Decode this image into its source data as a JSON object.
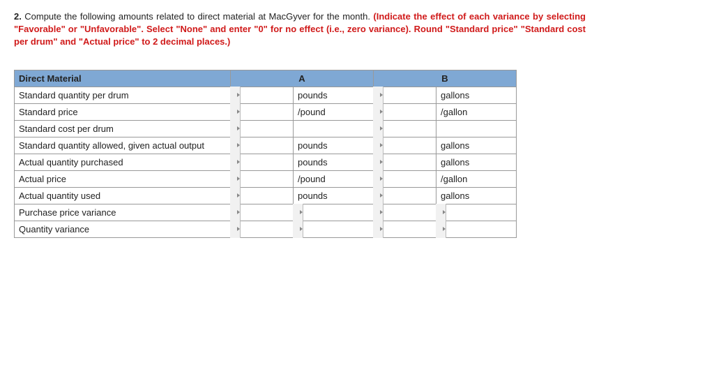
{
  "question": {
    "number": "2.",
    "prompt": "Compute the following amounts related to direct material at MacGyver for the month.",
    "instruction": "(Indicate the effect of each variance by selecting \"Favorable\" or \"Unfavorable\". Select \"None\" and enter \"0\" for no effect (i.e., zero variance). Round \"Standard price\" \"Standard cost per drum\" and \"Actual price\" to 2 decimal places.)"
  },
  "table": {
    "header": {
      "title": "Direct Material",
      "col_a": "A",
      "col_b": "B"
    },
    "rows": [
      {
        "label": "Standard quantity per drum",
        "unit_a": "pounds",
        "unit_b": "gallons"
      },
      {
        "label": "Standard price",
        "unit_a": "/pound",
        "unit_b": "/gallon"
      },
      {
        "label": "Standard cost per drum",
        "unit_a": "",
        "unit_b": ""
      },
      {
        "label": "Standard quantity allowed, given actual output",
        "unit_a": "pounds",
        "unit_b": "gallons"
      },
      {
        "label": "Actual quantity purchased",
        "unit_a": "pounds",
        "unit_b": "gallons"
      },
      {
        "label": "Actual price",
        "unit_a": "/pound",
        "unit_b": "/gallon"
      },
      {
        "label": "Actual quantity used",
        "unit_a": "pounds",
        "unit_b": "gallons"
      },
      {
        "label": "Purchase price variance",
        "unit_a": "",
        "unit_b": ""
      },
      {
        "label": "Quantity variance",
        "unit_a": "",
        "unit_b": ""
      }
    ]
  }
}
